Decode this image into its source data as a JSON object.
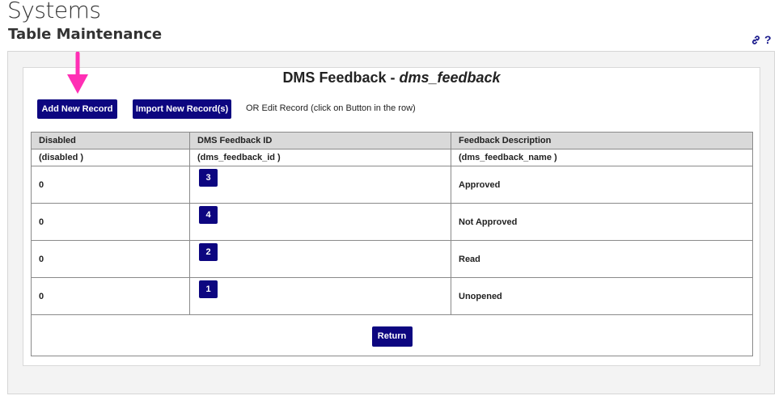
{
  "header": {
    "title": "Systems",
    "subtitle": "Table Maintenance",
    "link_icon": "link-icon",
    "help_label": "?"
  },
  "panel": {
    "heading_prefix": "DMS Feedback - ",
    "heading_table": "dms_feedback"
  },
  "actions": {
    "add_label": "Add New Record",
    "import_label": "Import New Record(s)",
    "edit_note": "OR Edit Record (click on Button in the row)"
  },
  "table": {
    "columns": [
      {
        "label": "Disabled",
        "field": "(disabled )"
      },
      {
        "label": "DMS Feedback ID",
        "field": "(dms_feedback_id )"
      },
      {
        "label": "Feedback Description",
        "field": "(dms_feedback_name )"
      }
    ],
    "rows": [
      {
        "disabled": "0",
        "id": "3",
        "name": "Approved"
      },
      {
        "disabled": "0",
        "id": "4",
        "name": "Not Approved"
      },
      {
        "disabled": "0",
        "id": "2",
        "name": "Read"
      },
      {
        "disabled": "0",
        "id": "1",
        "name": "Unopened"
      }
    ],
    "return_label": "Return"
  },
  "colors": {
    "button": "#0d0680",
    "arrow": "#ff2fb4",
    "header_bg": "#d9d9d9"
  }
}
